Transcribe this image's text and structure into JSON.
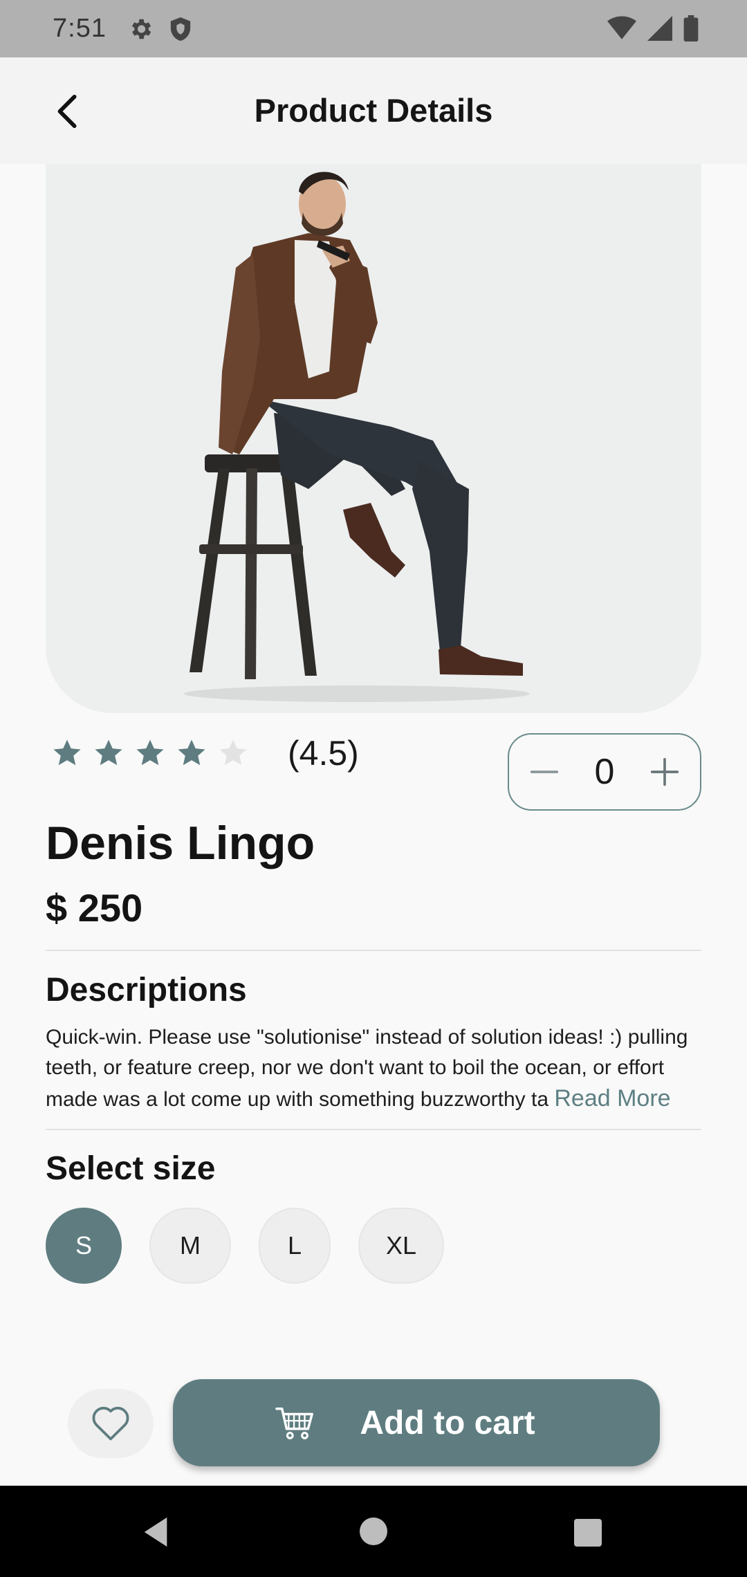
{
  "status_bar": {
    "time": "7:51",
    "icons": [
      "gear-icon",
      "shield-icon",
      "wifi-icon",
      "signal-icon",
      "battery-icon"
    ]
  },
  "header": {
    "title": "Product Details",
    "back_icon": "chevron-left-icon"
  },
  "product": {
    "image_alt": "Man in brown jacket sitting on a wooden stool",
    "rating": {
      "value_label": "(4.5)",
      "value": 4.5,
      "max": 5,
      "filled_color": "#5f7d80",
      "empty_color": "#e3e3e3"
    },
    "quantity": {
      "minus_icon": "minus-icon",
      "value": "0",
      "plus_icon": "plus-icon"
    },
    "name": "Denis Lingo",
    "price": "$ 250"
  },
  "description": {
    "title": "Descriptions",
    "text": "Quick-win. Please use \"solutionise\" instead of solution ideas! :) pulling teeth, or feature creep, nor we don't want to boil the ocean, or effort made was a lot come up with something buzzworthy ta ",
    "read_more": "Read More"
  },
  "size_select": {
    "title": "Select size",
    "options": [
      "S",
      "M",
      "L",
      "XL"
    ],
    "selected": "S"
  },
  "actions": {
    "favorite_icon": "heart-icon",
    "add_to_cart_label": "Add to cart",
    "cart_icon": "cart-icon"
  },
  "colors": {
    "accent": "#5f7d80",
    "background": "#f9f9f9",
    "header_bg": "#f3f3f3",
    "status_bar_bg": "#b1b1b1"
  },
  "nav_bar": {
    "icons": [
      "back-triangle-icon",
      "home-circle-icon",
      "recents-square-icon"
    ]
  }
}
